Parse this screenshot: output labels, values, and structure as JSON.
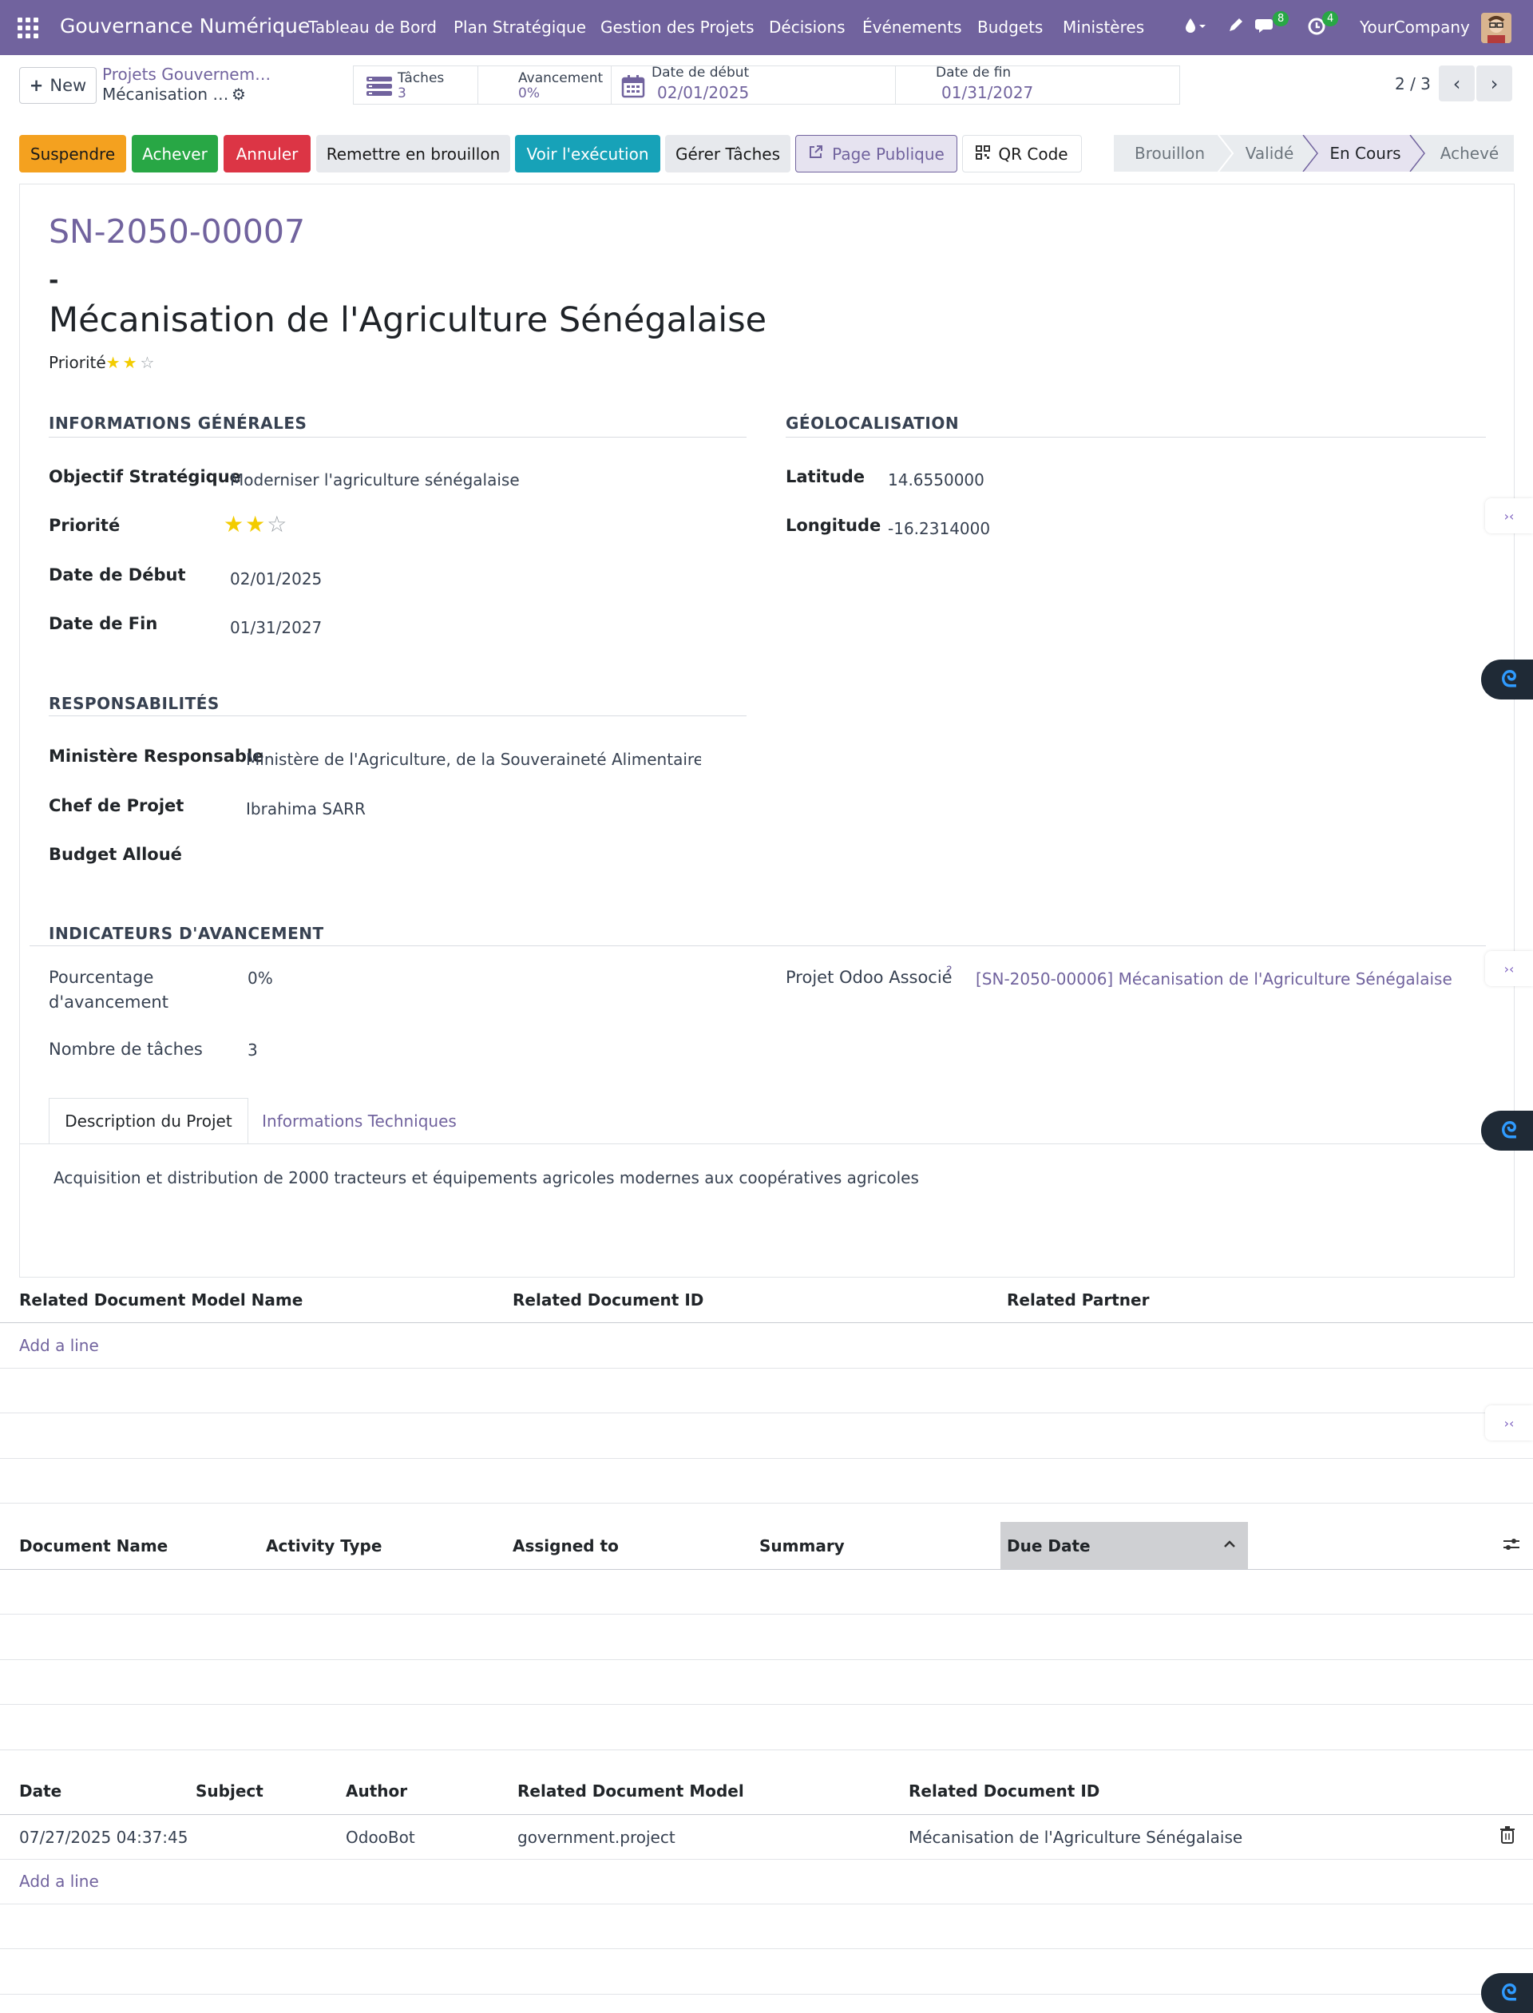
{
  "navbar": {
    "brand": "Gouvernance Numérique",
    "menu": [
      "Tableau de Bord",
      "Plan Stratégique",
      "Gestion des Projets",
      "Décisions",
      "Événements",
      "Budgets",
      "Ministères"
    ],
    "messages_count": "8",
    "activities_count": "4",
    "company": "YourCompany"
  },
  "control": {
    "new_label": "New",
    "breadcrumb_parent": "Projets Gouvernem…",
    "breadcrumb_current": "Mécanisation …",
    "stats": {
      "tasks_label": "Tâches",
      "tasks_value": "3",
      "progress_label": "Avancement",
      "progress_value": "0%",
      "start_label": "Date de début",
      "start_value": "02/01/2025",
      "end_label": "Date de fin",
      "end_value": "01/31/2027"
    },
    "pager": "2 / 3"
  },
  "actions": {
    "suspend": "Suspendre",
    "complete": "Achever",
    "cancel": "Annuler",
    "reset_draft": "Remettre en brouillon",
    "view_execution": "Voir l'exécution",
    "manage_tasks": "Gérer Tâches",
    "public_page": "Page Publique",
    "qr_code": "QR Code"
  },
  "statusbar": [
    "Brouillon",
    "Validé",
    "En Cours",
    "Achevé"
  ],
  "statusbar_active": "En Cours",
  "record": {
    "reference": "SN-2050-00007",
    "dash": "-",
    "title": "Mécanisation de l'Agriculture Sénégalaise",
    "priority_label": "Priorité",
    "priority_stars": 2
  },
  "general": {
    "section": "INFORMATIONS GÉNÉRALES",
    "objective_label": "Objectif Stratégique",
    "objective_value": "Moderniser l'agriculture sénégalaise",
    "priority_label": "Priorité",
    "start_label": "Date de Début",
    "start_value": "02/01/2025",
    "end_label": "Date de Fin",
    "end_value": "01/31/2027"
  },
  "geo": {
    "section": "GÉOLOCALISATION",
    "lat_label": "Latitude",
    "lat_value": "14.6550000",
    "lon_label": "Longitude",
    "lon_value": "-16.2314000"
  },
  "resp": {
    "section": "RESPONSABILITÉS",
    "ministry_label": "Ministère Responsable",
    "ministry_value": "Ministère de l'Agriculture, de la Souveraineté Alimentaire et d",
    "manager_label": "Chef de Projet",
    "manager_value": "Ibrahima SARR",
    "budget_label": "Budget Alloué"
  },
  "indicators": {
    "section": "INDICATEURS D'AVANCEMENT",
    "percent_label_1": "Pourcentage",
    "percent_label_2": "d'avancement",
    "percent_value": "0%",
    "tasks_label": "Nombre de tâches",
    "tasks_value": "3",
    "odoo_label": "Projet Odoo Associé",
    "odoo_help": "?",
    "odoo_value": "[SN-2050-00006] Mécanisation de l'Agriculture Sénégalaise"
  },
  "tabs": {
    "description": "Description du Projet",
    "technical": "Informations Techniques",
    "description_text": "Acquisition et distribution de 2000 tracteurs et équipements agricoles modernes aux coopératives agricoles"
  },
  "list1": {
    "headers": [
      "Related Document Model Name",
      "Related Document ID",
      "Related Partner"
    ],
    "add_line": "Add a line"
  },
  "list2": {
    "headers": [
      "Document Name",
      "Activity Type",
      "Assigned to",
      "Summary",
      "Due Date"
    ]
  },
  "list3": {
    "headers": [
      "Date",
      "Subject",
      "Author",
      "Related Document Model",
      "Related Document ID"
    ],
    "rows": [
      {
        "date": "07/27/2025 04:37:45",
        "subject": "",
        "author": "OdooBot",
        "model": "government.project",
        "doc_id": "Mécanisation de l'Agriculture Sénégalaise"
      }
    ],
    "add_line": "Add a line"
  },
  "colors": {
    "primary": "#71639e",
    "suspend": "#f4a11f",
    "complete": "#28a745",
    "cancel": "#dc3545",
    "info": "#17a2b8"
  }
}
